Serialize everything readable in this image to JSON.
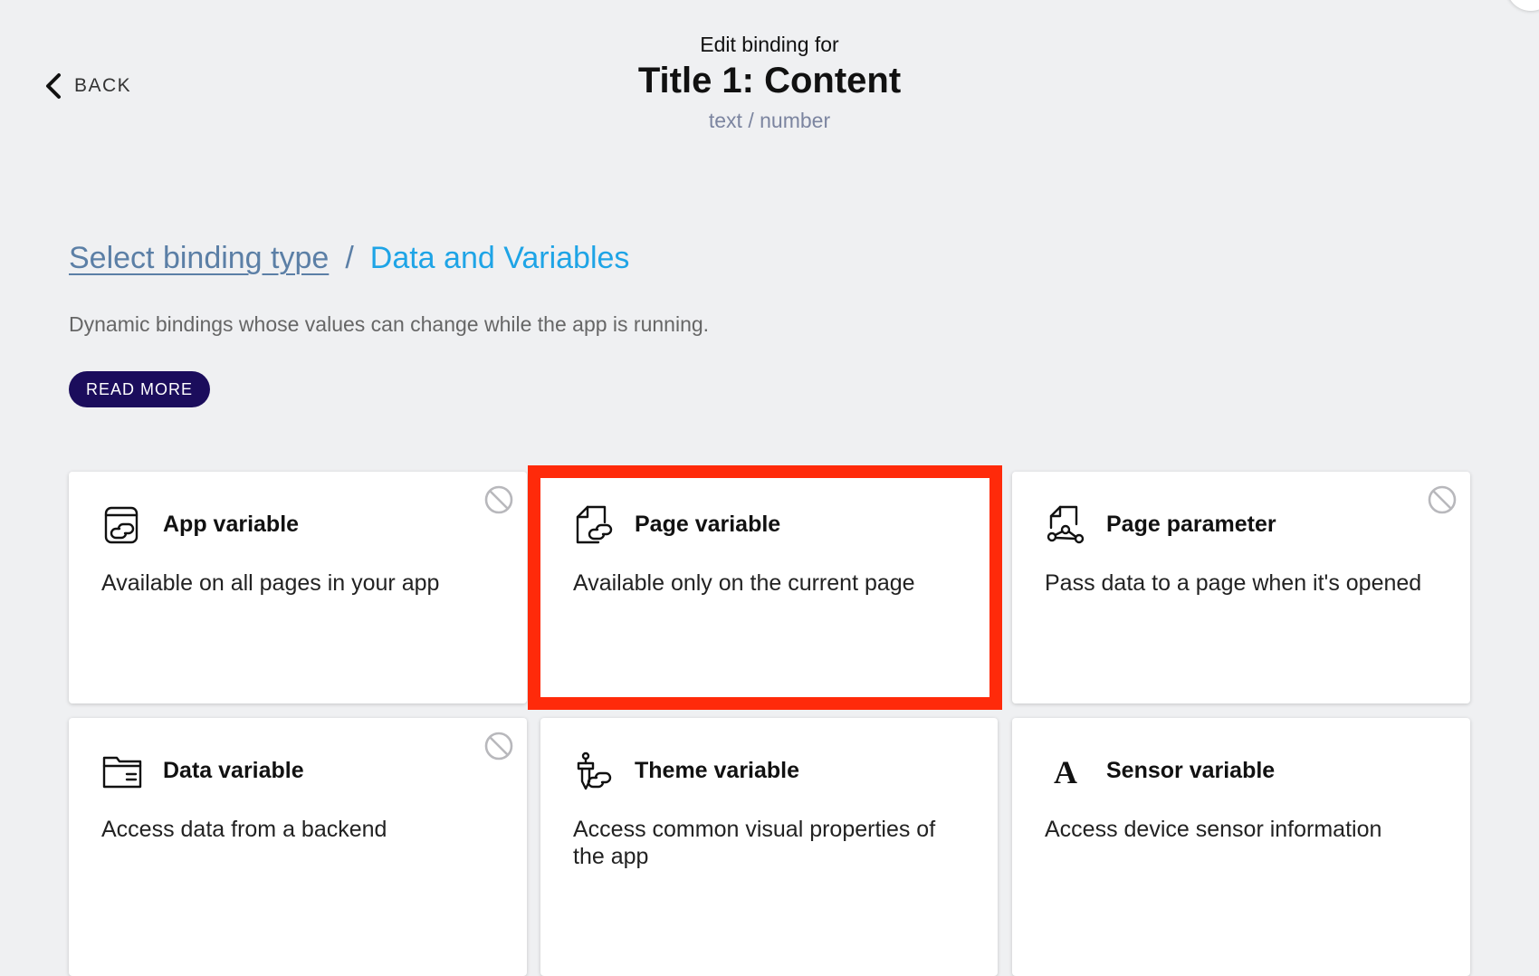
{
  "header": {
    "back_label": "BACK",
    "kicker": "Edit binding for",
    "title": "Title 1: Content",
    "subtitle": "text / number"
  },
  "breadcrumb": {
    "link": "Select binding type",
    "separator": "/",
    "current": "Data and Variables"
  },
  "description": "Dynamic bindings whose values can change while the app is running.",
  "read_more_label": "READ MORE",
  "colors": {
    "background": "#eff0f2",
    "accent_dark": "#1b0d5c",
    "link": "#5b7fa6",
    "current_crumb": "#1ea4e6",
    "highlight": "#ff2a0a"
  },
  "cards": [
    {
      "title": "App variable",
      "description": "Available on all pages in your app",
      "icon": "app-variable-icon",
      "disabled": true
    },
    {
      "title": "Page variable",
      "description": "Available only on the current page",
      "icon": "page-variable-icon",
      "disabled": false,
      "highlighted": true
    },
    {
      "title": "Page parameter",
      "description": "Pass data to a page when it's opened",
      "icon": "page-parameter-icon",
      "disabled": true
    },
    {
      "title": "Data variable",
      "description": "Access data from a backend",
      "icon": "data-variable-icon",
      "disabled": true
    },
    {
      "title": "Theme variable",
      "description": "Access common visual properties of the app",
      "icon": "theme-variable-icon",
      "disabled": false
    },
    {
      "title": "Sensor variable",
      "description": "Access device sensor information",
      "icon": "sensor-variable-icon",
      "disabled": false
    }
  ]
}
